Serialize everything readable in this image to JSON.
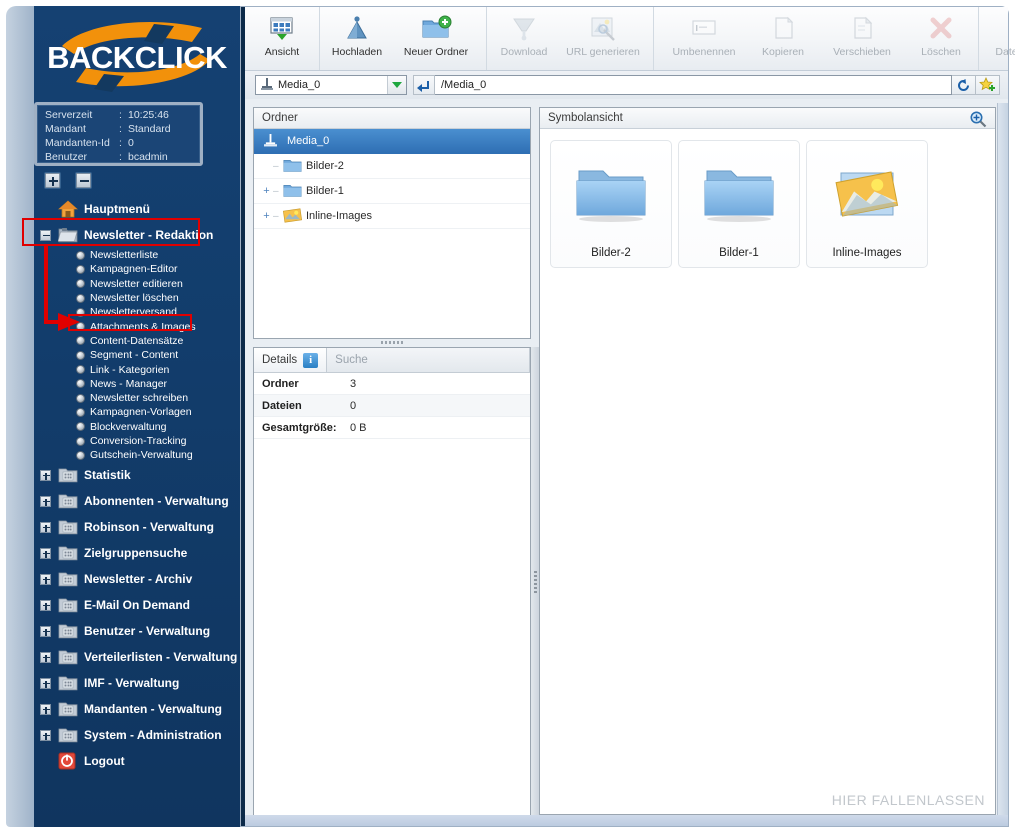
{
  "brand": {
    "logo_text": "BACKCLICK"
  },
  "server_info": {
    "rows": [
      {
        "label": "Serverzeit",
        "value": "10:25:46"
      },
      {
        "label": "Mandant",
        "value": "Standard"
      },
      {
        "label": "Mandanten-Id",
        "value": "0"
      },
      {
        "label": "Benutzer",
        "value": "bcadmin"
      }
    ]
  },
  "tree_controls": {
    "expand_all": "+",
    "collapse_all": "-"
  },
  "sidebar": {
    "items": [
      {
        "label": "Hauptmenü",
        "icon": "home-icon",
        "expander": "none",
        "type": "top"
      },
      {
        "label": "Newsletter - Redaktion",
        "icon": "folder-open-icon",
        "expander": "minus",
        "type": "top",
        "highlighted": true
      },
      {
        "label": "Statistik",
        "icon": "folder-icon",
        "expander": "plus",
        "type": "top"
      },
      {
        "label": "Abonnenten - Verwaltung",
        "icon": "folder-icon",
        "expander": "plus",
        "type": "top"
      },
      {
        "label": "Robinson - Verwaltung",
        "icon": "folder-icon",
        "expander": "plus",
        "type": "top"
      },
      {
        "label": "Zielgruppensuche",
        "icon": "folder-icon",
        "expander": "plus",
        "type": "top"
      },
      {
        "label": "Newsletter - Archiv",
        "icon": "folder-icon",
        "expander": "plus",
        "type": "top"
      },
      {
        "label": "E-Mail On Demand",
        "icon": "folder-icon",
        "expander": "plus",
        "type": "top"
      },
      {
        "label": "Benutzer - Verwaltung",
        "icon": "folder-icon",
        "expander": "plus",
        "type": "top"
      },
      {
        "label": "Verteilerlisten - Verwaltung",
        "icon": "folder-icon",
        "expander": "plus",
        "type": "top"
      },
      {
        "label": "IMF - Verwaltung",
        "icon": "folder-icon",
        "expander": "plus",
        "type": "top"
      },
      {
        "label": "Mandanten - Verwaltung",
        "icon": "folder-icon",
        "expander": "plus",
        "type": "top"
      },
      {
        "label": "System - Administration",
        "icon": "folder-icon",
        "expander": "plus",
        "type": "top"
      },
      {
        "label": "Logout",
        "icon": "logout-icon",
        "expander": "none",
        "type": "top"
      }
    ],
    "submenu": [
      {
        "label": "Newsletterliste"
      },
      {
        "label": "Kampagnen-Editor"
      },
      {
        "label": "Newsletter editieren"
      },
      {
        "label": "Newsletter löschen"
      },
      {
        "label": "Newsletterversand"
      },
      {
        "label": "Attachments & Images",
        "highlighted": true
      },
      {
        "label": "Content-Datensätze"
      },
      {
        "label": "Segment - Content"
      },
      {
        "label": "Link - Kategorien"
      },
      {
        "label": "News - Manager"
      },
      {
        "label": "Newsletter schreiben"
      },
      {
        "label": "Kampagnen-Vorlagen"
      },
      {
        "label": "Blockverwaltung"
      },
      {
        "label": "Conversion-Tracking"
      },
      {
        "label": "Gutschein-Verwaltung"
      }
    ]
  },
  "toolbar": {
    "groups": [
      {
        "buttons": [
          {
            "label": "Ansicht",
            "icon": "view-grid-icon",
            "enabled": true,
            "accel": ""
          }
        ]
      },
      {
        "buttons": [
          {
            "label": "Hochladen",
            "icon": "upload-icon",
            "enabled": true,
            "accel": "H"
          },
          {
            "label": "Neuer Ordner",
            "icon": "new-folder-icon",
            "enabled": true,
            "accel": "O"
          }
        ]
      },
      {
        "buttons": [
          {
            "label": "Download",
            "icon": "download-icon",
            "enabled": false,
            "accel": "l"
          },
          {
            "label": "URL generieren",
            "icon": "url-icon",
            "enabled": false,
            "accel": ""
          }
        ]
      },
      {
        "buttons": [
          {
            "label": "Umbenennen",
            "icon": "rename-icon",
            "enabled": false,
            "accel": "U"
          },
          {
            "label": "Kopieren",
            "icon": "copy-icon",
            "enabled": false,
            "accel": "K"
          },
          {
            "label": "Verschieben",
            "icon": "move-icon",
            "enabled": false,
            "accel": "V"
          },
          {
            "label": "Löschen",
            "icon": "delete-icon",
            "enabled": false,
            "accel": "L"
          }
        ]
      },
      {
        "buttons": [
          {
            "label": "Datei Löschen",
            "icon": "delete-file-icon",
            "enabled": false,
            "accel": ""
          }
        ]
      }
    ]
  },
  "pathbar": {
    "drive": {
      "value": "Media_0",
      "icon": "drive-icon"
    },
    "up_button_icon": "up-arrow-icon",
    "path": {
      "value": "/Media_0",
      "placeholder": "/Media_0"
    },
    "refresh_icon": "refresh-icon",
    "favorite_icon": "star-add-icon"
  },
  "tree_panel": {
    "title": "Ordner",
    "nodes": [
      {
        "label": "Media_0",
        "icon": "drive-icon",
        "expander": "",
        "selected": true,
        "indent": 0
      },
      {
        "label": "Bilder-2",
        "icon": "folder-icon",
        "expander": "",
        "selected": false,
        "indent": 1
      },
      {
        "label": "Bilder-1",
        "icon": "folder-icon",
        "expander": "+",
        "selected": false,
        "indent": 1
      },
      {
        "label": "Inline-Images",
        "icon": "folder-image-icon",
        "expander": "+",
        "selected": false,
        "indent": 1
      }
    ]
  },
  "details_panel": {
    "tabs": [
      {
        "label": "Details",
        "active": true,
        "badge": "i"
      },
      {
        "label": "Suche",
        "active": false,
        "badge": ""
      }
    ],
    "rows": [
      {
        "key": "Ordner",
        "value": "3"
      },
      {
        "key": "Dateien",
        "value": "0"
      },
      {
        "key": "Gesamtgröße:",
        "value": "0 B"
      }
    ]
  },
  "symbol_panel": {
    "title": "Symbolansicht",
    "zoom_icon": "zoom-in-icon",
    "items": [
      {
        "label": "Bilder-2",
        "icon": "folder-icon"
      },
      {
        "label": "Bilder-1",
        "icon": "folder-icon"
      },
      {
        "label": "Inline-Images",
        "icon": "folder-image-icon"
      }
    ],
    "drop_hint": "HIER FALLENLASSEN"
  },
  "colors": {
    "sidebar_dark": "#123d6c",
    "accent_orange": "#f2910b",
    "annotation_red": "#e00000",
    "selection_blue": "#2f6fb4"
  }
}
